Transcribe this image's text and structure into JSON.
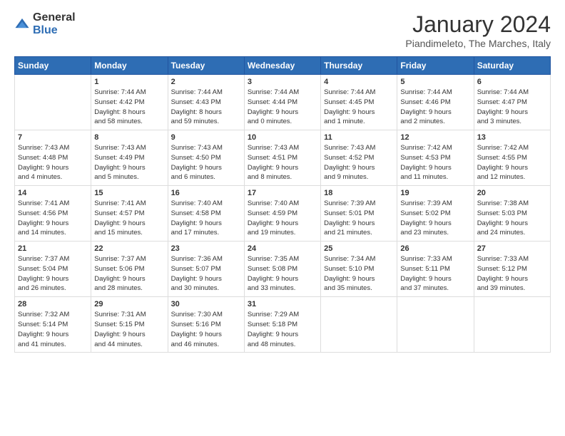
{
  "logo": {
    "general": "General",
    "blue": "Blue"
  },
  "title": "January 2024",
  "location": "Piandimeleto, The Marches, Italy",
  "days_header": [
    "Sunday",
    "Monday",
    "Tuesday",
    "Wednesday",
    "Thursday",
    "Friday",
    "Saturday"
  ],
  "weeks": [
    [
      {
        "day": "",
        "info": ""
      },
      {
        "day": "1",
        "info": "Sunrise: 7:44 AM\nSunset: 4:42 PM\nDaylight: 8 hours\nand 58 minutes."
      },
      {
        "day": "2",
        "info": "Sunrise: 7:44 AM\nSunset: 4:43 PM\nDaylight: 8 hours\nand 59 minutes."
      },
      {
        "day": "3",
        "info": "Sunrise: 7:44 AM\nSunset: 4:44 PM\nDaylight: 9 hours\nand 0 minutes."
      },
      {
        "day": "4",
        "info": "Sunrise: 7:44 AM\nSunset: 4:45 PM\nDaylight: 9 hours\nand 1 minute."
      },
      {
        "day": "5",
        "info": "Sunrise: 7:44 AM\nSunset: 4:46 PM\nDaylight: 9 hours\nand 2 minutes."
      },
      {
        "day": "6",
        "info": "Sunrise: 7:44 AM\nSunset: 4:47 PM\nDaylight: 9 hours\nand 3 minutes."
      }
    ],
    [
      {
        "day": "7",
        "info": "Sunrise: 7:43 AM\nSunset: 4:48 PM\nDaylight: 9 hours\nand 4 minutes."
      },
      {
        "day": "8",
        "info": "Sunrise: 7:43 AM\nSunset: 4:49 PM\nDaylight: 9 hours\nand 5 minutes."
      },
      {
        "day": "9",
        "info": "Sunrise: 7:43 AM\nSunset: 4:50 PM\nDaylight: 9 hours\nand 6 minutes."
      },
      {
        "day": "10",
        "info": "Sunrise: 7:43 AM\nSunset: 4:51 PM\nDaylight: 9 hours\nand 8 minutes."
      },
      {
        "day": "11",
        "info": "Sunrise: 7:43 AM\nSunset: 4:52 PM\nDaylight: 9 hours\nand 9 minutes."
      },
      {
        "day": "12",
        "info": "Sunrise: 7:42 AM\nSunset: 4:53 PM\nDaylight: 9 hours\nand 11 minutes."
      },
      {
        "day": "13",
        "info": "Sunrise: 7:42 AM\nSunset: 4:55 PM\nDaylight: 9 hours\nand 12 minutes."
      }
    ],
    [
      {
        "day": "14",
        "info": "Sunrise: 7:41 AM\nSunset: 4:56 PM\nDaylight: 9 hours\nand 14 minutes."
      },
      {
        "day": "15",
        "info": "Sunrise: 7:41 AM\nSunset: 4:57 PM\nDaylight: 9 hours\nand 15 minutes."
      },
      {
        "day": "16",
        "info": "Sunrise: 7:40 AM\nSunset: 4:58 PM\nDaylight: 9 hours\nand 17 minutes."
      },
      {
        "day": "17",
        "info": "Sunrise: 7:40 AM\nSunset: 4:59 PM\nDaylight: 9 hours\nand 19 minutes."
      },
      {
        "day": "18",
        "info": "Sunrise: 7:39 AM\nSunset: 5:01 PM\nDaylight: 9 hours\nand 21 minutes."
      },
      {
        "day": "19",
        "info": "Sunrise: 7:39 AM\nSunset: 5:02 PM\nDaylight: 9 hours\nand 23 minutes."
      },
      {
        "day": "20",
        "info": "Sunrise: 7:38 AM\nSunset: 5:03 PM\nDaylight: 9 hours\nand 24 minutes."
      }
    ],
    [
      {
        "day": "21",
        "info": "Sunrise: 7:37 AM\nSunset: 5:04 PM\nDaylight: 9 hours\nand 26 minutes."
      },
      {
        "day": "22",
        "info": "Sunrise: 7:37 AM\nSunset: 5:06 PM\nDaylight: 9 hours\nand 28 minutes."
      },
      {
        "day": "23",
        "info": "Sunrise: 7:36 AM\nSunset: 5:07 PM\nDaylight: 9 hours\nand 30 minutes."
      },
      {
        "day": "24",
        "info": "Sunrise: 7:35 AM\nSunset: 5:08 PM\nDaylight: 9 hours\nand 33 minutes."
      },
      {
        "day": "25",
        "info": "Sunrise: 7:34 AM\nSunset: 5:10 PM\nDaylight: 9 hours\nand 35 minutes."
      },
      {
        "day": "26",
        "info": "Sunrise: 7:33 AM\nSunset: 5:11 PM\nDaylight: 9 hours\nand 37 minutes."
      },
      {
        "day": "27",
        "info": "Sunrise: 7:33 AM\nSunset: 5:12 PM\nDaylight: 9 hours\nand 39 minutes."
      }
    ],
    [
      {
        "day": "28",
        "info": "Sunrise: 7:32 AM\nSunset: 5:14 PM\nDaylight: 9 hours\nand 41 minutes."
      },
      {
        "day": "29",
        "info": "Sunrise: 7:31 AM\nSunset: 5:15 PM\nDaylight: 9 hours\nand 44 minutes."
      },
      {
        "day": "30",
        "info": "Sunrise: 7:30 AM\nSunset: 5:16 PM\nDaylight: 9 hours\nand 46 minutes."
      },
      {
        "day": "31",
        "info": "Sunrise: 7:29 AM\nSunset: 5:18 PM\nDaylight: 9 hours\nand 48 minutes."
      },
      {
        "day": "",
        "info": ""
      },
      {
        "day": "",
        "info": ""
      },
      {
        "day": "",
        "info": ""
      }
    ]
  ]
}
